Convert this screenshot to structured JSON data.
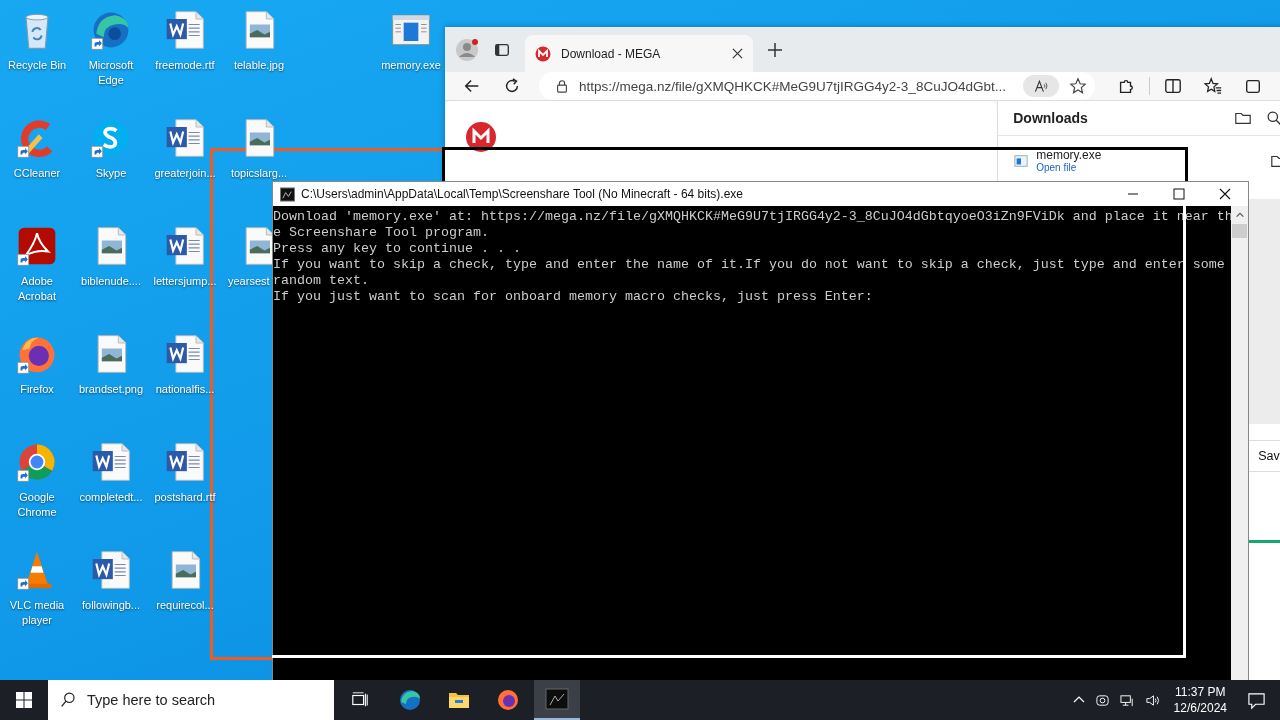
{
  "desktop": {
    "icons": [
      {
        "label": "Recycle Bin",
        "kind": "recycle",
        "shortcut": false
      },
      {
        "label": "CCleaner",
        "kind": "ccleaner",
        "shortcut": true
      },
      {
        "label": "Adobe Acrobat",
        "kind": "acrobat",
        "shortcut": true
      },
      {
        "label": "Firefox",
        "kind": "firefox",
        "shortcut": true
      },
      {
        "label": "Google Chrome",
        "kind": "chrome",
        "shortcut": true
      },
      {
        "label": "VLC media player",
        "kind": "vlc",
        "shortcut": true
      },
      {
        "label": "Microsoft Edge",
        "kind": "edge",
        "shortcut": true
      },
      {
        "label": "Skype",
        "kind": "skype",
        "shortcut": true
      },
      {
        "label": "biblenude....",
        "kind": "image",
        "shortcut": false
      },
      {
        "label": "brandset.png",
        "kind": "image",
        "shortcut": false
      },
      {
        "label": "completedt...",
        "kind": "word",
        "shortcut": false
      },
      {
        "label": "followingb...",
        "kind": "word",
        "shortcut": false
      },
      {
        "label": "freemode.rtf",
        "kind": "word",
        "shortcut": false
      },
      {
        "label": "greaterjoin...",
        "kind": "word",
        "shortcut": false
      },
      {
        "label": "lettersjump...",
        "kind": "word",
        "shortcut": false
      },
      {
        "label": "nationalfis...",
        "kind": "word",
        "shortcut": false
      },
      {
        "label": "postshard.rtf",
        "kind": "word",
        "shortcut": false
      },
      {
        "label": "requirecol...",
        "kind": "image",
        "shortcut": false
      },
      {
        "label": "telable.jpg",
        "kind": "image",
        "shortcut": false
      },
      {
        "label": "topicslarg...",
        "kind": "image",
        "shortcut": false
      },
      {
        "label": "yearsest",
        "kind": "image",
        "shortcut": false,
        "cut": true
      }
    ],
    "loose_icon": {
      "label": "memory.exe",
      "kind": "exe",
      "shortcut": false
    }
  },
  "browser": {
    "tab": {
      "title": "Download - MEGA",
      "selected": true
    },
    "address": "https://mega.nz/file/gXMQHKCK#MeG9U7tjIRGG4y2-3_8CuJO4dGbt...",
    "downloads": {
      "title": "Downloads",
      "items": [
        {
          "name": "memory.exe",
          "action": "Open file"
        }
      ],
      "button": "Sav"
    }
  },
  "console": {
    "title": "C:\\Users\\admin\\AppData\\Local\\Temp\\Screenshare Tool (No Minecraft - 64 bits).exe",
    "lines": [
      "Download 'memory.exe' at: https://mega.nz/file/gXMQHKCK#MeG9U7tjIRGG4y2-3_8CuJO4dGbtqyoeO3iZn9FViDk and place it near th",
      "e Screenshare Tool program.",
      "Press any key to continue . . .",
      "If you want to skip a check, type and enter the name of it.If you do not want to skip a check, just type and enter some",
      "random text.",
      "If you just want to scan for onboard memory macro checks, just press Enter:"
    ]
  },
  "taskbar": {
    "search_placeholder": "Type here to search",
    "apps": [
      {
        "kind": "edge",
        "selected": false
      },
      {
        "kind": "explorer",
        "selected": false
      },
      {
        "kind": "firefox",
        "selected": false
      },
      {
        "kind": "console",
        "selected": true
      }
    ],
    "time": "11:37 PM",
    "date": "12/6/2024"
  }
}
